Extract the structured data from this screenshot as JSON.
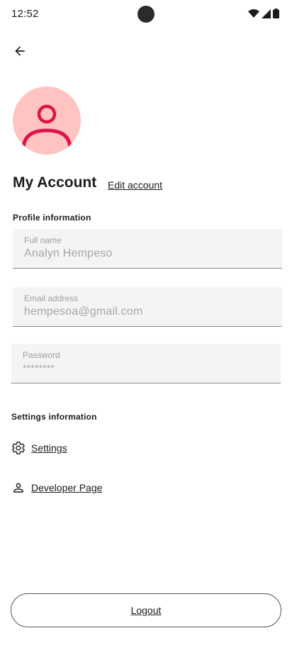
{
  "status_bar": {
    "time": "12:52",
    "icons": [
      "wifi-icon",
      "signal-icon",
      "battery-icon"
    ]
  },
  "header": {
    "back_icon": "arrow-left-icon"
  },
  "profile": {
    "avatar_icon": "person-icon",
    "avatar_bg": "#ffc4c2",
    "avatar_fg": "#e0134a",
    "title": "My Account",
    "edit_label": "Edit account"
  },
  "profile_information": {
    "section_label": "Profile information",
    "fields": [
      {
        "label": "Full name",
        "value": "Analyn Hempeso"
      },
      {
        "label": "Email address",
        "value": "hempesoa@gmail.com"
      },
      {
        "label": "Password",
        "value": "********"
      }
    ]
  },
  "settings_information": {
    "section_label": "Settings information",
    "items": [
      {
        "label": "Settings",
        "icon": "gear-icon"
      },
      {
        "label": "Developer Page",
        "icon": "person-outline-icon"
      }
    ]
  },
  "footer": {
    "logout_label": "Logout"
  }
}
